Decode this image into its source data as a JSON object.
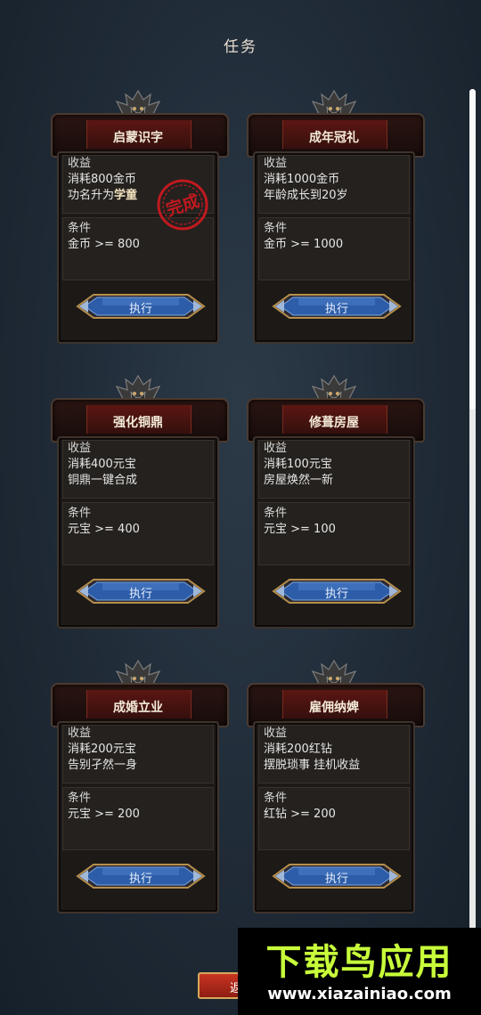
{
  "page": {
    "title": "任务"
  },
  "tasks": [
    {
      "name": "启蒙识字",
      "revenue_header": "收益",
      "revenue_line1": "消耗800金币",
      "revenue_line2_prefix": "功名升为",
      "revenue_line2_highlight": "学童",
      "condition_header": "条件",
      "condition": "金币 >= 800",
      "button": "执行",
      "status_stamp": "完成"
    },
    {
      "name": "成年冠礼",
      "revenue_header": "收益",
      "revenue_line1": "消耗1000金币",
      "revenue_line2": "年龄成长到20岁",
      "condition_header": "条件",
      "condition": "金币 >= 1000",
      "button": "执行"
    },
    {
      "name": "强化铜鼎",
      "revenue_header": "收益",
      "revenue_line1": "消耗400元宝",
      "revenue_line2": "铜鼎一键合成",
      "condition_header": "条件",
      "condition": "元宝 >= 400",
      "button": "执行"
    },
    {
      "name": "修葺房屋",
      "revenue_header": "收益",
      "revenue_line1": "消耗100元宝",
      "revenue_line2": "房屋焕然一新",
      "condition_header": "条件",
      "condition": "元宝 >= 100",
      "button": "执行"
    },
    {
      "name": "成婚立业",
      "revenue_header": "收益",
      "revenue_line1": "消耗200元宝",
      "revenue_line2": "告别孑然一身",
      "condition_header": "条件",
      "condition": "元宝 >= 200",
      "button": "执行"
    },
    {
      "name": "雇佣纳婢",
      "revenue_header": "收益",
      "revenue_line1": "消耗200红钻",
      "revenue_line2": "摆脱琐事 挂机收益",
      "condition_header": "条件",
      "condition": "红钻 >= 200",
      "button": "执行"
    }
  ],
  "footer": {
    "return_button_label": "返"
  },
  "watermark": {
    "text": "下载鸟应用",
    "url": "www.xiazainiao.com"
  },
  "colors": {
    "accent_button": "#2f5fa8",
    "banner_red": "#5c1612",
    "stamp_red": "#c0191f"
  }
}
